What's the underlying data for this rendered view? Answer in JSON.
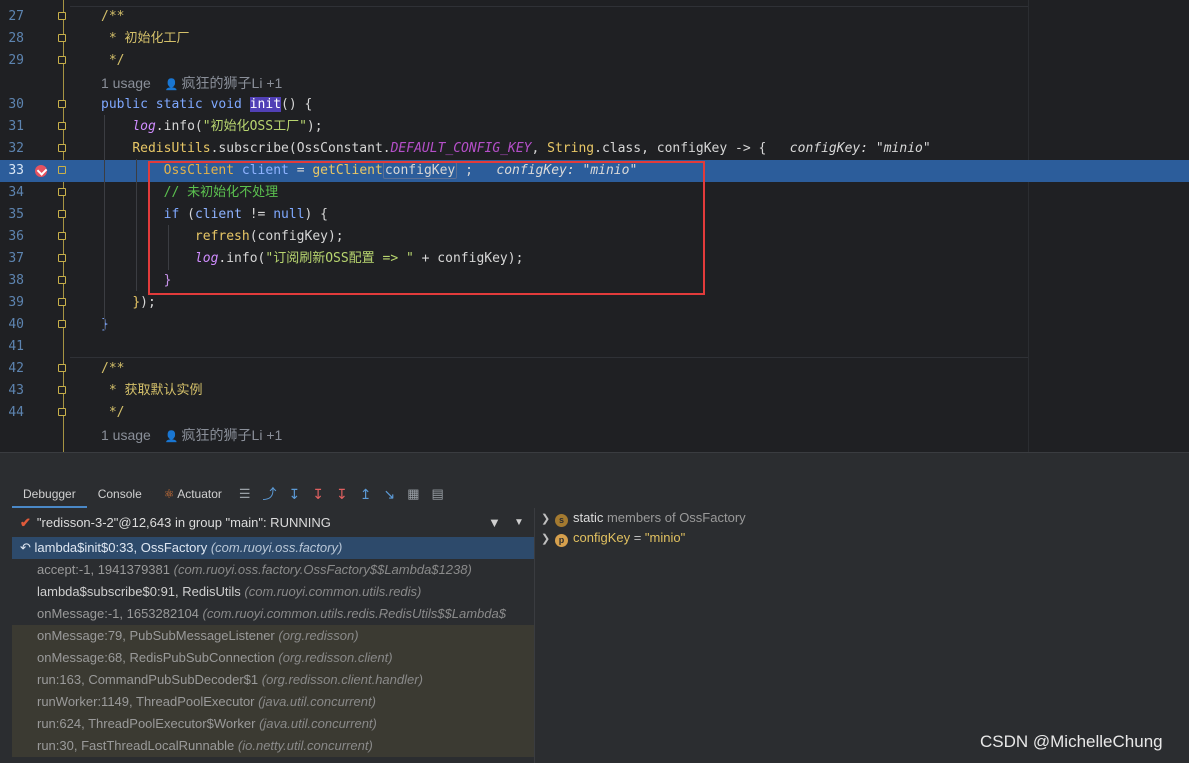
{
  "editor": {
    "lines": [
      {
        "n": "27",
        "parts": [
          [
            "cm",
            "/**"
          ]
        ]
      },
      {
        "n": "28",
        "parts": [
          [
            "cm",
            " * 初始化工厂"
          ]
        ]
      },
      {
        "n": "29",
        "parts": [
          [
            "cm",
            " */"
          ]
        ]
      },
      {
        "n": "30",
        "parts": [
          [
            "kw2",
            "public static void "
          ],
          [
            "hl",
            "init"
          ],
          [
            "",
            "() {"
          ]
        ]
      },
      {
        "n": "31",
        "parts": [
          [
            "",
            "    "
          ],
          [
            "log",
            "log"
          ],
          [
            "",
            ".info("
          ],
          [
            "str",
            "\"初始化OSS工厂\""
          ],
          [
            "",
            ");"
          ]
        ]
      },
      {
        "n": "32",
        "parts": [
          [
            "",
            "    "
          ],
          [
            "fn",
            "RedisUtils"
          ],
          [
            "",
            ".subscribe("
          ],
          [
            "",
            "OssConstant."
          ],
          [
            "const",
            "DEFAULT_CONFIG_KEY"
          ],
          [
            "",
            ", "
          ],
          [
            "fn",
            "String"
          ],
          [
            "",
            ".class, configKey -> {  "
          ],
          [
            "iv",
            " configKey: \"minio\""
          ]
        ]
      },
      {
        "n": "33",
        "parts": [
          [
            "",
            "        "
          ],
          [
            "cls",
            "OssClient"
          ],
          [
            "var",
            " client"
          ],
          [
            "",
            " = "
          ],
          [
            "fn",
            "getClient"
          ],
          [
            "box",
            "configKey"
          ],
          [
            "",
            " ;  "
          ],
          [
            "iv",
            " configKey: \"minio\""
          ]
        ]
      },
      {
        "n": "34",
        "parts": [
          [
            "",
            "        "
          ],
          [
            "cm2",
            "// 未初始化不处理"
          ]
        ]
      },
      {
        "n": "35",
        "parts": [
          [
            "",
            "        "
          ],
          [
            "kw2",
            "if"
          ],
          [
            "",
            " ("
          ],
          [
            "var",
            "client"
          ],
          [
            "",
            " != "
          ],
          [
            "kw2",
            "null"
          ],
          [
            "",
            ") {"
          ]
        ]
      },
      {
        "n": "36",
        "parts": [
          [
            "",
            "            "
          ],
          [
            "fn",
            "refresh"
          ],
          [
            "",
            "(configKey);"
          ]
        ]
      },
      {
        "n": "37",
        "parts": [
          [
            "",
            "            "
          ],
          [
            "log",
            "log"
          ],
          [
            "",
            ".info("
          ],
          [
            "str",
            "\"订阅刷新OSS配置 => \""
          ],
          [
            "",
            " + configKey);"
          ]
        ]
      },
      {
        "n": "38",
        "parts": [
          [
            "",
            "        "
          ],
          [
            "kw",
            "}"
          ]
        ]
      },
      {
        "n": "39",
        "parts": [
          [
            "",
            "    "
          ],
          [
            "fn",
            "}"
          ],
          [
            "",
            ");"
          ]
        ]
      },
      {
        "n": "40",
        "parts": [
          [
            "kw2",
            "}"
          ]
        ]
      },
      {
        "n": "41",
        "parts": []
      },
      {
        "n": "42",
        "parts": [
          [
            "cm",
            "/**"
          ]
        ]
      },
      {
        "n": "43",
        "parts": [
          [
            "cm",
            " * 获取默认实例"
          ]
        ]
      },
      {
        "n": "44",
        "parts": [
          [
            "cm",
            " */"
          ]
        ]
      }
    ],
    "usage_hint": {
      "label": "1 usage",
      "author": "疯狂的狮子Li +1"
    }
  },
  "debugger": {
    "tabs": [
      "Debugger",
      "Console",
      "Actuator"
    ],
    "thread": "\"redisson-3-2\"@12,643 in group \"main\": RUNNING",
    "frames": [
      {
        "name": "lambda$init$0:33, OssFactory",
        "pkg": "(com.ruoyi.oss.factory)",
        "style": "selected"
      },
      {
        "name": "accept:-1, 1941379381",
        "pkg": "(com.ruoyi.oss.factory.OssFactory$$Lambda$1238)",
        "style": ""
      },
      {
        "name": "lambda$subscribe$0:91, RedisUtils",
        "pkg": "(com.ruoyi.common.utils.redis)",
        "style": "bright"
      },
      {
        "name": "onMessage:-1, 1653282104",
        "pkg": "(com.ruoyi.common.utils.redis.RedisUtils$$Lambda$",
        "style": ""
      },
      {
        "name": "onMessage:79, PubSubMessageListener",
        "pkg": "(org.redisson)",
        "style": "lib"
      },
      {
        "name": "onMessage:68, RedisPubSubConnection",
        "pkg": "(org.redisson.client)",
        "style": "lib"
      },
      {
        "name": "run:163, CommandPubSubDecoder$1",
        "pkg": "(org.redisson.client.handler)",
        "style": "lib"
      },
      {
        "name": "runWorker:1149, ThreadPoolExecutor",
        "pkg": "(java.util.concurrent)",
        "style": "lib"
      },
      {
        "name": "run:624, ThreadPoolExecutor$Worker",
        "pkg": "(java.util.concurrent)",
        "style": "lib"
      },
      {
        "name": "run:30, FastThreadLocalRunnable",
        "pkg": "(io.netty.util.concurrent)",
        "style": "lib"
      }
    ],
    "variables": [
      {
        "badge": "s",
        "name": "static",
        "rest": " members of OssFactory"
      },
      {
        "badge": "p",
        "name": "configKey",
        "rest": " = ",
        "value": "\"minio\""
      }
    ]
  },
  "watermark": "CSDN @MichelleChung"
}
